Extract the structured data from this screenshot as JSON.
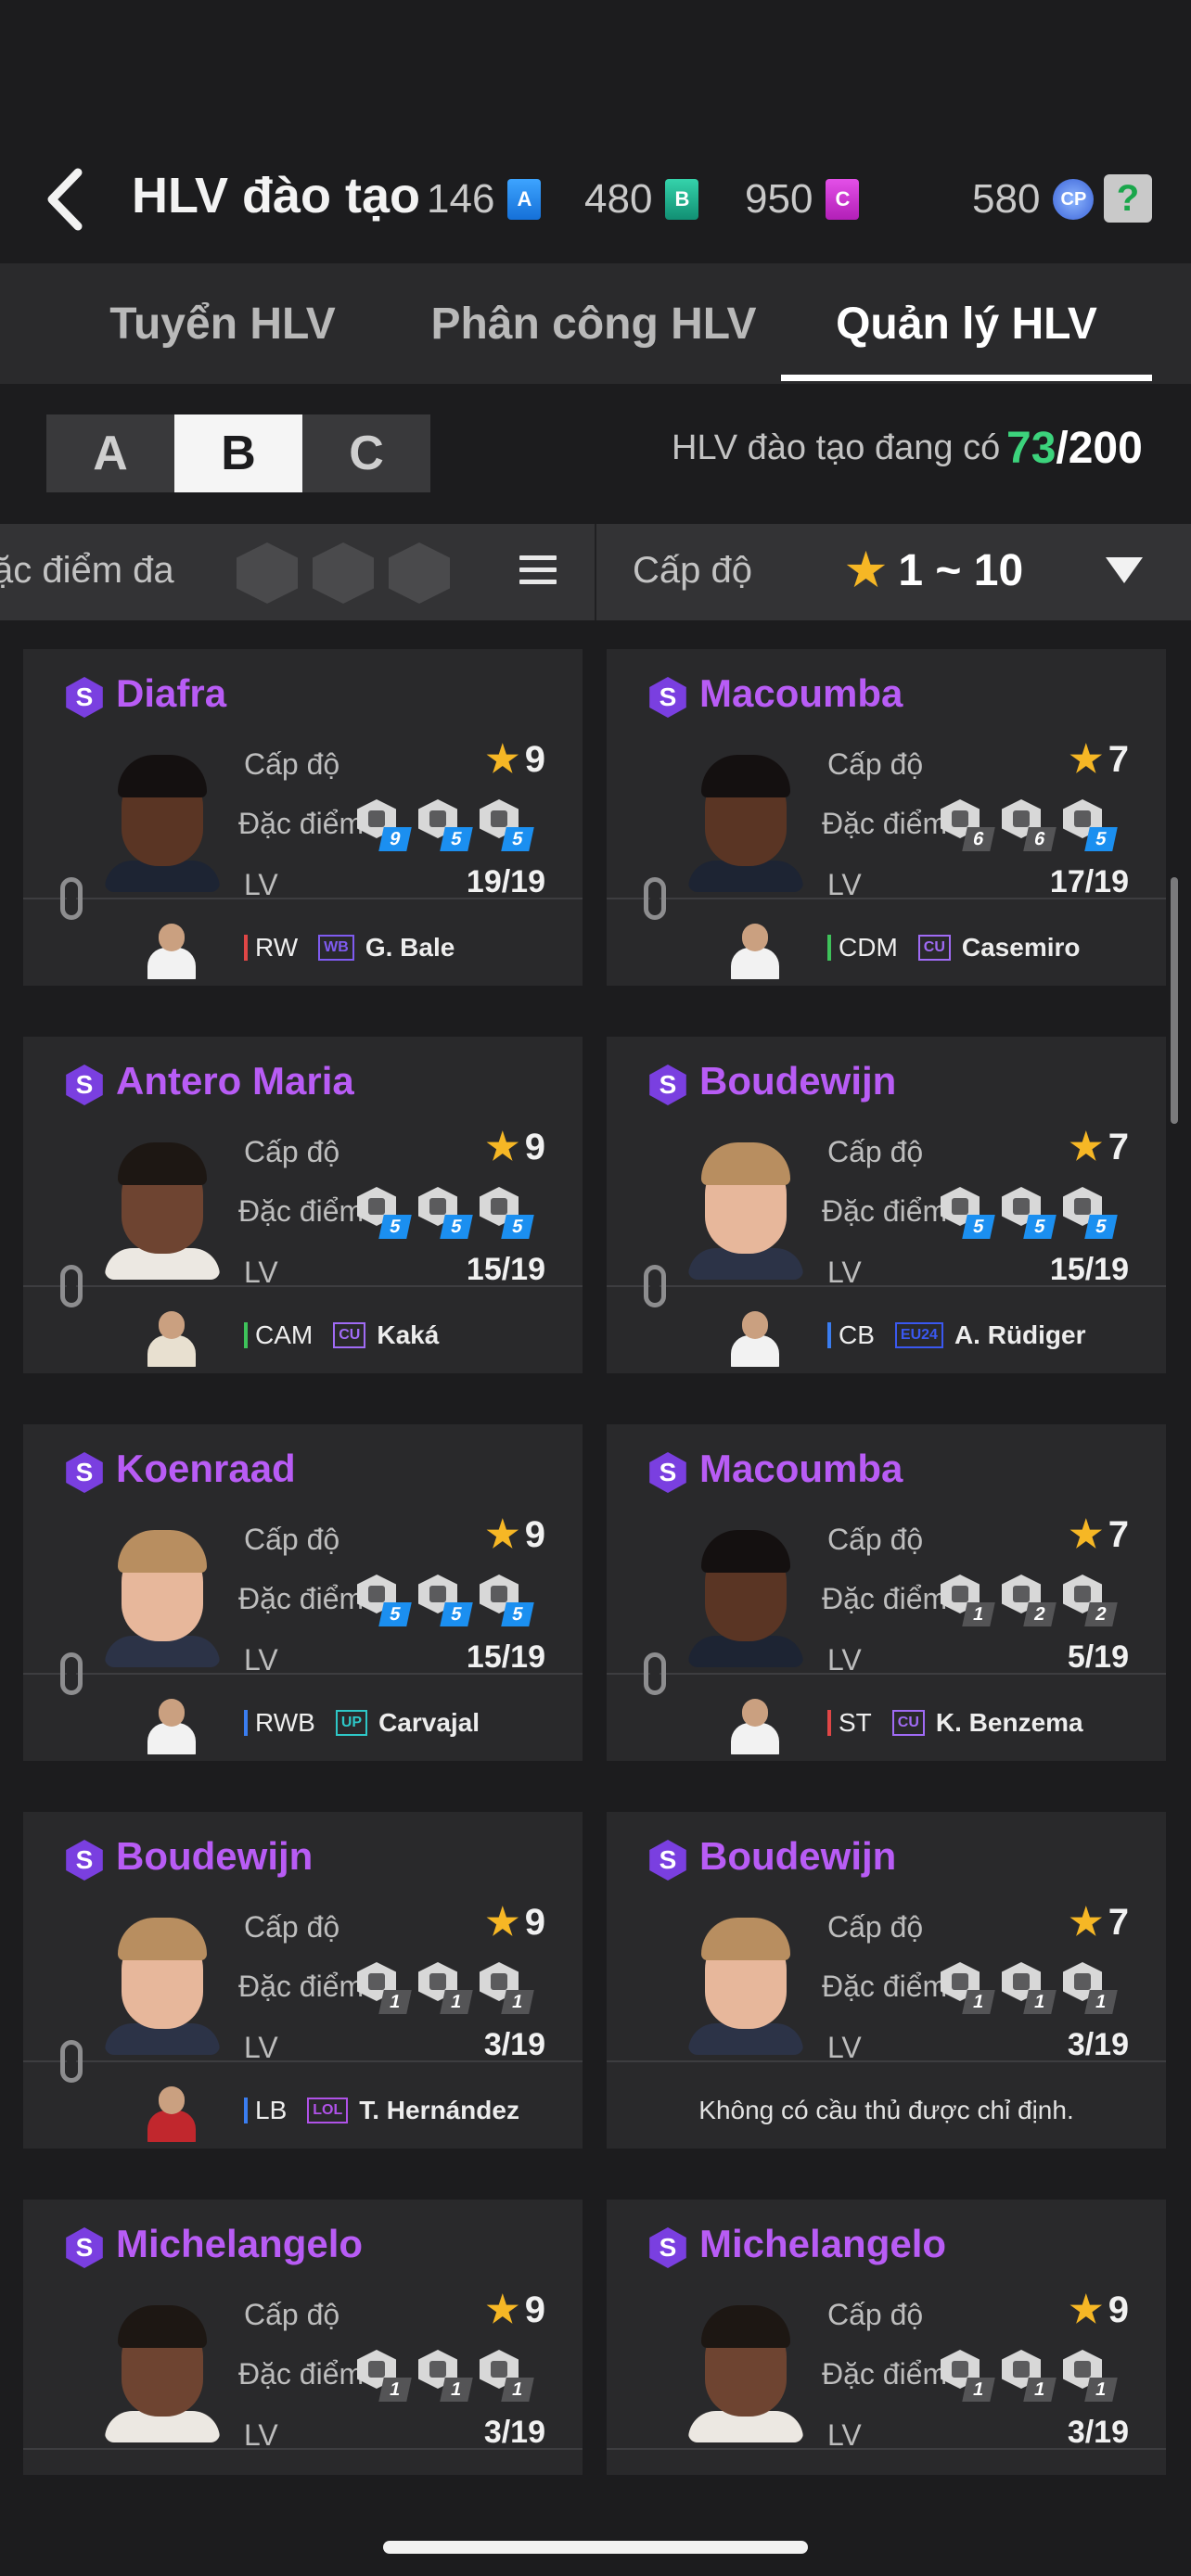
{
  "header": {
    "title": "HLV đào tạo",
    "currency": [
      {
        "value": "146",
        "icon": "A"
      },
      {
        "value": "480",
        "icon": "B"
      },
      {
        "value": "950",
        "icon": "C"
      },
      {
        "value": "580",
        "icon": "CP"
      }
    ],
    "help": "?"
  },
  "tabs": [
    "Tuyển HLV",
    "Phân công  HLV",
    "Quản lý HLV"
  ],
  "grades": [
    "A",
    "B",
    "C"
  ],
  "stats": {
    "label": "HLV đào tạo đang có",
    "current": "73",
    "max": "/200"
  },
  "filter": {
    "trait_label": "ặc điểm đa",
    "level_label": "Cấp độ",
    "level_range": "1 ~ 10"
  },
  "labels": {
    "level": "Cấp độ",
    "trait": "Đặc điểm",
    "lv": "LV"
  },
  "cards": [
    {
      "name": "Diafra",
      "level": "9",
      "lv": "19/19",
      "traits": [
        "9",
        "5",
        "5"
      ],
      "pos": "RW",
      "season": "WB",
      "player": "G. Bale",
      "pos_color": "#e04646",
      "season_color": "#7f5bf0"
    },
    {
      "name": "Macoumba",
      "level": "7",
      "lv": "17/19",
      "traits": [
        "6",
        "6",
        "5"
      ],
      "pos": "CDM",
      "season": "CU",
      "player": "Casemiro",
      "pos_color": "#3ec25a",
      "season_color": "#a06bf5"
    },
    {
      "name": "Antero Maria",
      "level": "9",
      "lv": "15/19",
      "traits": [
        "5",
        "5",
        "5"
      ],
      "pos": "CAM",
      "season": "CU",
      "player": "Kaká",
      "pos_color": "#3ec25a",
      "season_color": "#a06bf5"
    },
    {
      "name": "Boudewijn",
      "level": "7",
      "lv": "15/19",
      "traits": [
        "5",
        "5",
        "5"
      ],
      "pos": "CB",
      "season": "EU24",
      "player": "A. Rüdiger",
      "pos_color": "#3a7df0",
      "season_color": "#3a58f0"
    },
    {
      "name": "Koenraad",
      "level": "9",
      "lv": "15/19",
      "traits": [
        "5",
        "5",
        "5"
      ],
      "pos": "RWB",
      "season": "UP",
      "player": "Carvajal",
      "pos_color": "#3a7df0",
      "season_color": "#2ec7c7"
    },
    {
      "name": "Macoumba",
      "level": "7",
      "lv": "5/19",
      "traits": [
        "1",
        "2",
        "2"
      ],
      "pos": "ST",
      "season": "CU",
      "player": "K. Benzema",
      "pos_color": "#e04646",
      "season_color": "#a06bf5"
    },
    {
      "name": "Boudewijn",
      "level": "9",
      "lv": "3/19",
      "traits": [
        "1",
        "1",
        "1"
      ],
      "pos": "LB",
      "season": "LOL",
      "player": "T. Hernández",
      "pos_color": "#3a7df0",
      "season_color": "#b052e8"
    },
    {
      "name": "Boudewijn",
      "level": "7",
      "lv": "3/19",
      "traits": [
        "1",
        "1",
        "1"
      ],
      "no_player": "Không có cầu thủ được chỉ định."
    },
    {
      "name": "Michelangelo",
      "level": "9",
      "lv": "3/19",
      "traits": [
        "1",
        "1",
        "1"
      ]
    },
    {
      "name": "Michelangelo",
      "level": "9",
      "lv": "3/19",
      "traits": [
        "1",
        "1",
        "1"
      ]
    }
  ],
  "colors": {
    "accent_purple": "#b85cf5",
    "count_green": "#3cd37c",
    "star": "#f6b725",
    "trait_blue": "#1b8ff0"
  }
}
